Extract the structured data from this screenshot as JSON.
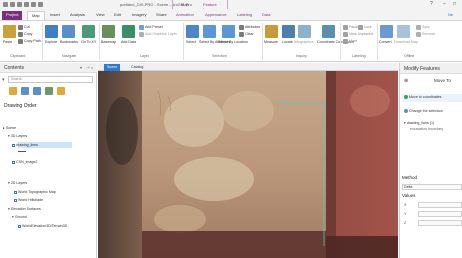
{
  "app": {
    "title": "portland_GIS.PRO - Scene - ArcGIS Pro",
    "context_tabs": [
      "Map",
      "Feature Layer"
    ],
    "window_controls": [
      "?",
      "–",
      "□"
    ]
  },
  "ribbon": {
    "tabs": [
      "Project",
      "Map",
      "Insert",
      "Analysis",
      "View",
      "Edit",
      "Imagery",
      "Share",
      "Animation",
      "Appearance",
      "Labeling",
      "Data"
    ],
    "active_tab": "Map",
    "groups": [
      {
        "name": "Clipboard",
        "items": [
          "Paste",
          "Cut",
          "Copy",
          "Copy Path"
        ]
      },
      {
        "name": "Navigate",
        "items": [
          "Explore",
          "Bookmarks",
          "Go To XY"
        ]
      },
      {
        "name": "Layer",
        "items": [
          "Basemap",
          "Add Data",
          "Add Preset",
          "Add Graphics Layer"
        ]
      },
      {
        "name": "Selection",
        "items": [
          "Select",
          "Select By Attributes",
          "Select By Location",
          "Attributes",
          "Clear"
        ]
      },
      {
        "name": "Inquiry",
        "items": [
          "Measure",
          "Locate",
          "Infographics",
          "Coordinate Conversion"
        ]
      },
      {
        "name": "Labeling",
        "items": [
          "Pause",
          "Lock",
          "View Unplaced",
          "More"
        ]
      },
      {
        "name": "Offline",
        "items": [
          "Convert",
          "Download Map",
          "Sync",
          "Remove"
        ]
      }
    ],
    "right_label": "Ne"
  },
  "contents": {
    "title": "Contents",
    "search_placeholder": "Search",
    "drawing_order": "Drawing Order",
    "tree": [
      {
        "label": "Scene",
        "level": 0
      },
      {
        "label": "3D Layers",
        "level": 1
      },
      {
        "label": "drawing_lines",
        "level": 2,
        "checked": true,
        "selected": true
      },
      {
        "label": "CSN_image2",
        "level": 2,
        "checked": true
      },
      {
        "label": "2D Layers",
        "level": 1
      },
      {
        "label": "World Topographic Map",
        "level": 2,
        "checked": false
      },
      {
        "label": "World Hillshade",
        "level": 2,
        "checked": false
      },
      {
        "label": "Elevation Surfaces",
        "level": 1
      },
      {
        "label": "Ground",
        "level": 2
      },
      {
        "label": "WorldElevation3D/Terrain3D",
        "level": 3,
        "checked": false
      }
    ]
  },
  "mapview": {
    "tabs": [
      "Scene",
      "Catalog"
    ],
    "active_tab": "Scene"
  },
  "modify": {
    "title": "Modify Features",
    "tool_name": "Move To",
    "rows": [
      "Move to coordinates",
      "Change the selection"
    ],
    "feature": "drawing_lines (1)",
    "feature_sub": "excavation boundary",
    "method_label": "Method",
    "method_value": "Delta",
    "values_label": "Values",
    "axes": [
      "X",
      "Y",
      "Z"
    ]
  },
  "colors": {
    "project_tab": "#7b2e7b",
    "accent": "#2d7ad6",
    "selection": "#cce4f7"
  }
}
